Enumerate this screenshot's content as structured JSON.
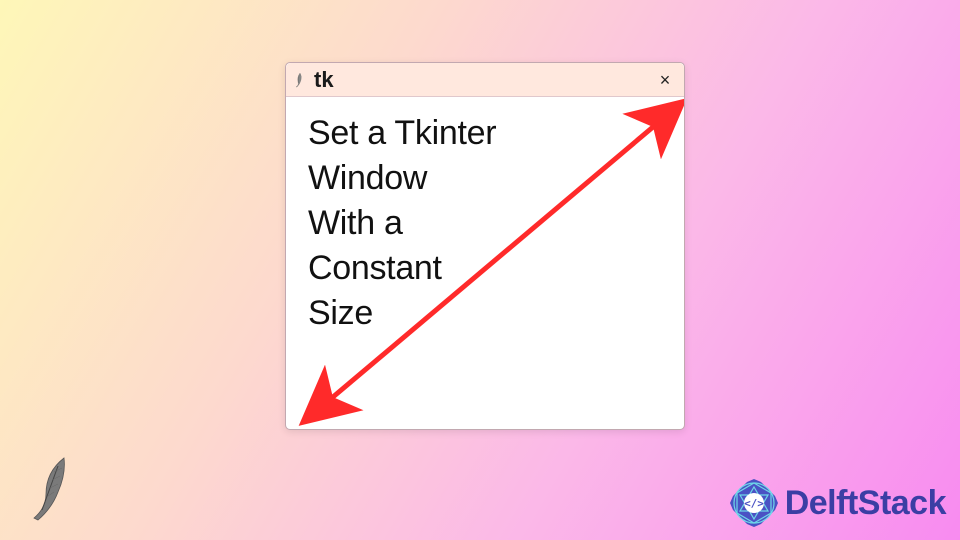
{
  "window": {
    "title": "tk",
    "bodyLines": [
      "Set a Tkinter",
      "Window",
      "With a",
      "Constant",
      "Size"
    ]
  },
  "arrow": {
    "color": "#ff2a2a"
  },
  "brand": {
    "name": "DelftStack",
    "color": "#3b3ea4"
  }
}
